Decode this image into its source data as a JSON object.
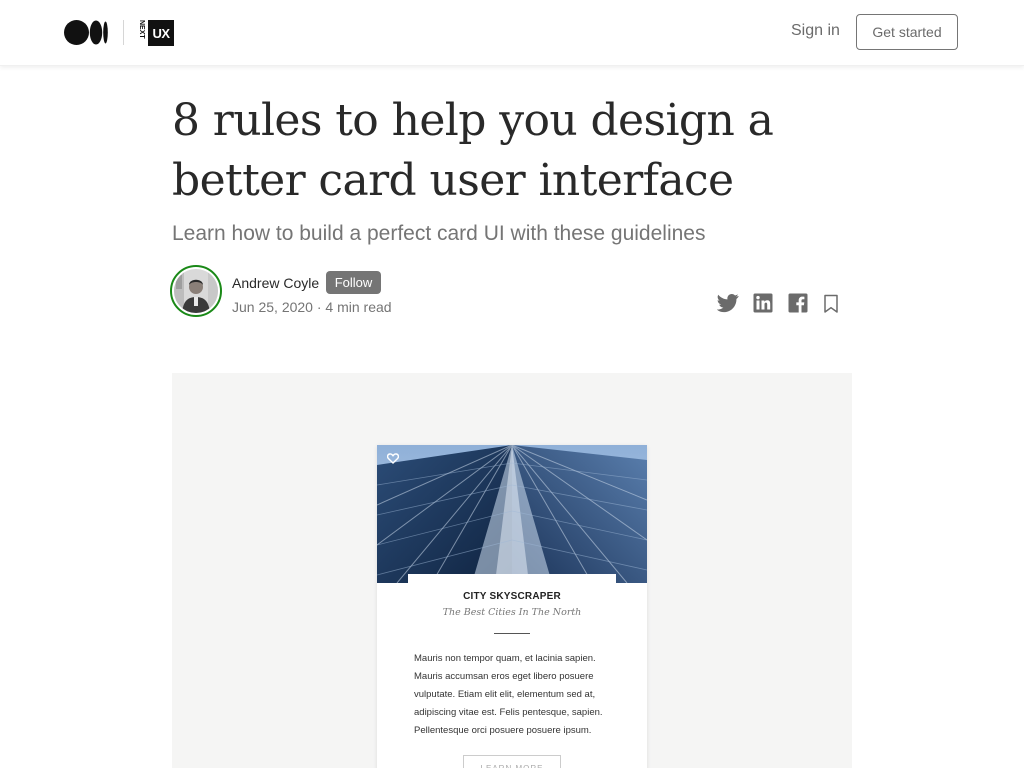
{
  "nav": {
    "publication_logo": {
      "vertical_text": "NEXT",
      "badge_text": "UX"
    },
    "sign_in_label": "Sign in",
    "get_started_label": "Get started"
  },
  "article": {
    "title": "8 rules to help you design a better card user interface",
    "subtitle": "Learn how to build a perfect card UI with these guidelines",
    "author": {
      "name": "Andrew Coyle",
      "follow_label": "Follow",
      "date": "Jun 25, 2020",
      "separator": " · ",
      "read_time": "4 min read"
    },
    "share_icons": [
      "twitter-icon",
      "linkedin-icon",
      "facebook-icon",
      "bookmark-icon"
    ]
  },
  "figure": {
    "card": {
      "title": "CITY SKYSCRAPER",
      "subtitle": "The Best Cities In The North",
      "body": "Mauris non tempor quam, et lacinia sapien. Mauris accumsan eros eget libero posuere vulputate. Etiam elit elit, elementum sed at, adipiscing vitae est. Felis pentesque, sapien. Pellentesque orci posuere posuere ipsum.",
      "button_label": "LEARN MORE",
      "icon": "heart-icon"
    }
  },
  "colors": {
    "accent_green": "#1a8917",
    "text_primary": "#292929",
    "text_secondary": "#757575",
    "figure_background": "#f5f5f4"
  }
}
